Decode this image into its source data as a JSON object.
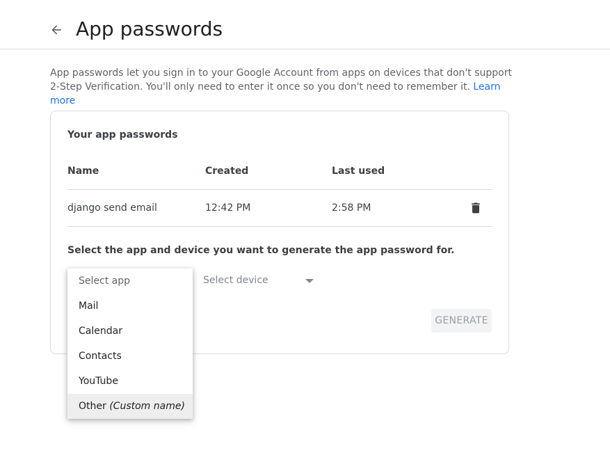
{
  "header": {
    "back_icon": "arrow-back-icon",
    "title": "App passwords"
  },
  "description": {
    "text": "App passwords let you sign in to your Google Account from apps on devices that don't support 2-Step Verification. You'll only need to enter it once so you don't need to remember it.",
    "learn_more": "Learn more"
  },
  "card": {
    "heading": "Your app passwords",
    "columns": [
      "Name",
      "Created",
      "Last used"
    ],
    "rows": [
      {
        "name": "django send email",
        "created": "12:42 PM",
        "last_used": "2:58 PM",
        "action_icon": "trash-icon"
      }
    ],
    "select_prompt": "Select the app and device you want to generate the app password for.",
    "device_select": {
      "placeholder": "Select device"
    },
    "generate_label": "GENERATE"
  },
  "app_menu": {
    "placeholder": "Select app",
    "items": [
      "Mail",
      "Calendar",
      "Contacts",
      "YouTube"
    ],
    "other": {
      "label": "Other",
      "hint": "(Custom name)"
    },
    "highlighted": "Other"
  },
  "colors": {
    "link": "#1a73e8",
    "divider": "#dadce0",
    "disabled_button_bg": "#f1f3f4",
    "disabled_button_text": "#9aa0a6",
    "menu_highlight": "#eeeeee"
  }
}
